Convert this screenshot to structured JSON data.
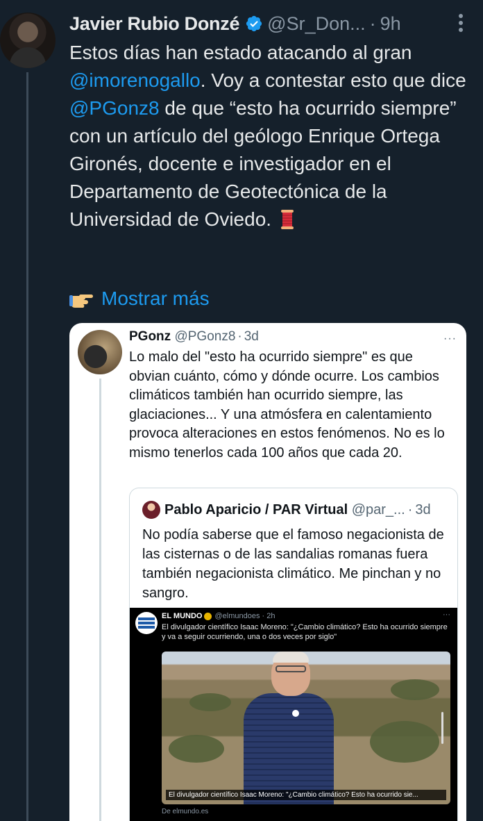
{
  "tweet": {
    "author_name": "Javier Rubio Donzé",
    "author_handle": "@Sr_Don...",
    "dot": "·",
    "time": "9h",
    "text_parts": {
      "p1": "Estos días han estado atacando al gran ",
      "m1": "@imorenogallo",
      "p2": ". Voy a contestar esto que dice ",
      "m2": "@PGonz8",
      "p3": " de que “esto ha ocurrido siempre” con un artículo del geólogo Enrique Ortega Gironés, docente e investigador en el Departamento de Geotectónica de la Universidad de Oviedo."
    },
    "show_more": "Mostrar más",
    "icons": [
      "verified-badge-icon",
      "more-vertical-icon",
      "spool-of-thread-emoji",
      "pointing-hand-emoji"
    ]
  },
  "quote": {
    "author_name": "PGonz",
    "author_handle": "@PGonz8",
    "dot": "·",
    "time": "3d",
    "more": "···",
    "text": "Lo malo del \"esto ha ocurrido siempre\" es que obvian cuánto, cómo y dónde ocurre. Los cambios climáticos también han ocurrido siempre, las glaciaciones... Y una atmósfera en calentamiento provoca alteraciones en estos fenómenos. No es lo mismo tenerlos cada 100 años que cada 20."
  },
  "inner_quote": {
    "author_name": "Pablo Aparicio / PAR Virtual",
    "author_handle": "@par_...",
    "dot": "·",
    "time": "3d",
    "text": "No podía saberse que el famoso negacionista de las cisternas o de las sandalias romanas fuera también negacionista climático. Me pinchan y no sangro."
  },
  "embedded_screenshot": {
    "author_name": "EL MUNDO",
    "author_handle": "@elmundoes · 2h",
    "more": "···",
    "text": "El divulgador científico Isaac Moreno: \"¿Cambio climático? Esto ha ocurrido siempre y va a seguir ocurriendo, una o dos veces por siglo\"",
    "caption": "El divulgador científico Isaac Moreno: \"¿Cambio climático? Esto ha ocurrido sie...",
    "source": "De elmundo.es"
  },
  "colors": {
    "background": "#15202b",
    "link": "#1d9bf0",
    "muted": "#8b98a5",
    "card": "#ffffff"
  }
}
